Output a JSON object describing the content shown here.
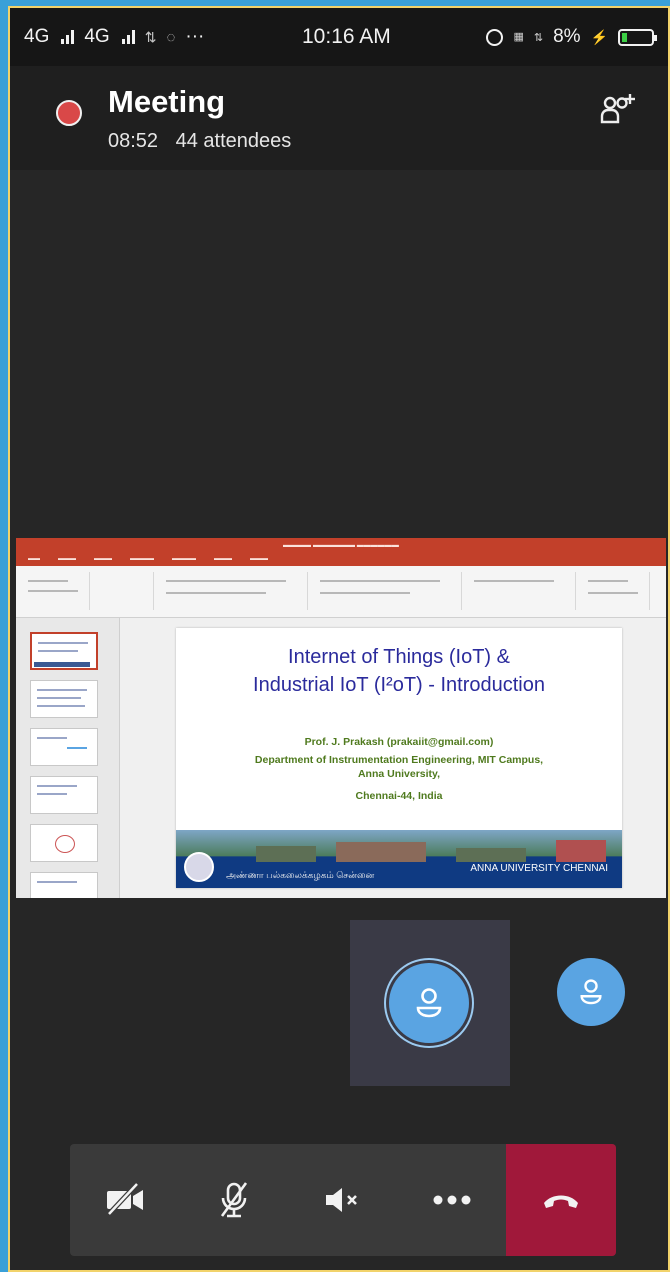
{
  "status_bar": {
    "network1": "4G",
    "network2": "4G",
    "time": "10:16 AM",
    "battery": "8%"
  },
  "meeting": {
    "title": "Meeting",
    "duration": "08:52",
    "attendees": "44 attendees"
  },
  "slide": {
    "title_line1": "Internet of Things (IoT) &",
    "title_line2": "Industrial IoT (I²oT) - Introduction",
    "author": "Prof. J. Prakash (prakaiit@gmail.com)",
    "department": "Department of Instrumentation Engineering, MIT Campus,",
    "university": "Anna University,",
    "city": "Chennai-44, India",
    "banner_tamil": "அண்ணா பல்கலைக்கழகம் சென்னை",
    "banner_english": "ANNA UNIVERSITY CHENNAI"
  },
  "controls": [
    "camera-off",
    "mic-off",
    "speaker-off",
    "more",
    "hang-up"
  ],
  "colors": {
    "recording": "#d94848",
    "hangup": "#a0183a",
    "avatar": "#5aa4e2",
    "slide_title": "#2b2b9c"
  }
}
